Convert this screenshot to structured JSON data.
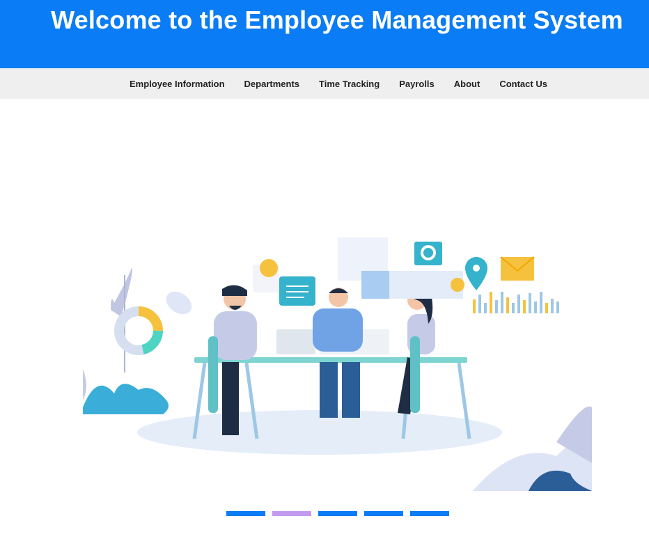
{
  "header": {
    "title": "Welcome to the Employee Management System"
  },
  "nav": {
    "items": [
      "Employee Information",
      "Departments",
      "Time Tracking",
      "Payrolls",
      "About",
      "Contact Us"
    ]
  },
  "carousel": {
    "slide_count": 5,
    "active_index": 1,
    "colors": {
      "inactive": "#0a7cf5",
      "active": "#c49af0"
    }
  },
  "colors": {
    "header_bg": "#0a7cf5",
    "nav_bg": "#efefef"
  }
}
